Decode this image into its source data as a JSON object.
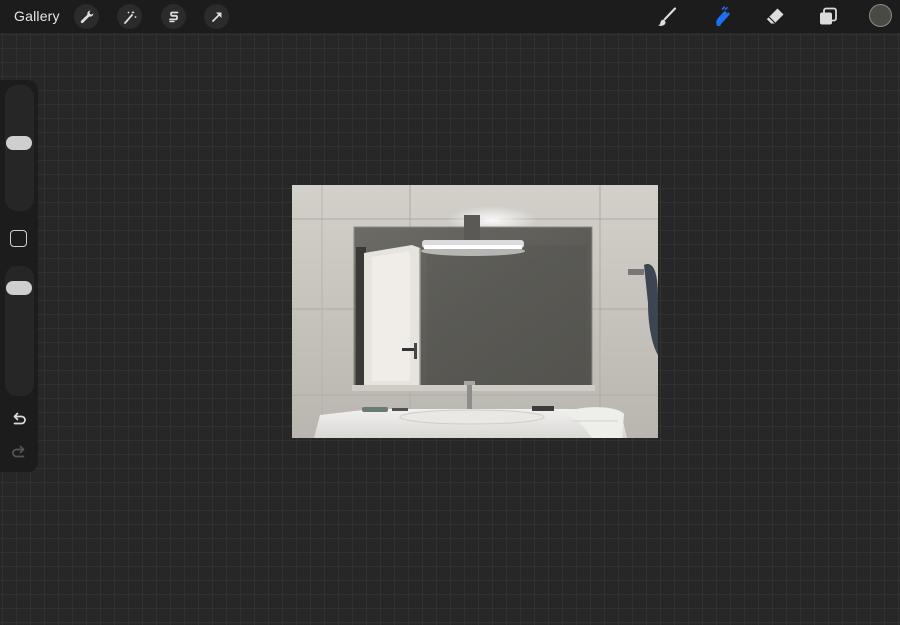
{
  "topbar": {
    "gallery_label": "Gallery",
    "left_tools": [
      {
        "name": "actions",
        "icon": "wrench-icon"
      },
      {
        "name": "adjustments",
        "icon": "magic-wand-icon"
      },
      {
        "name": "selection",
        "icon": "selection-s-icon"
      },
      {
        "name": "transform",
        "icon": "arrow-cursor-icon"
      }
    ],
    "right_tools": [
      {
        "name": "brush",
        "icon": "brush-icon",
        "active": false
      },
      {
        "name": "smudge",
        "icon": "smudge-icon",
        "active": true
      },
      {
        "name": "eraser",
        "icon": "eraser-icon",
        "active": false
      },
      {
        "name": "layers",
        "icon": "layers-icon",
        "active": false
      }
    ],
    "current_color": "#4a4a44",
    "active_color": "#1e6ff0"
  },
  "sidebar": {
    "brush_size_level": 0.55,
    "opacity_level": 0.9,
    "modify_icon": "square-modify-icon",
    "undo_icon": "undo-icon",
    "redo_icon": "redo-icon"
  },
  "canvas": {
    "content": "bathroom-mirror-photo"
  }
}
